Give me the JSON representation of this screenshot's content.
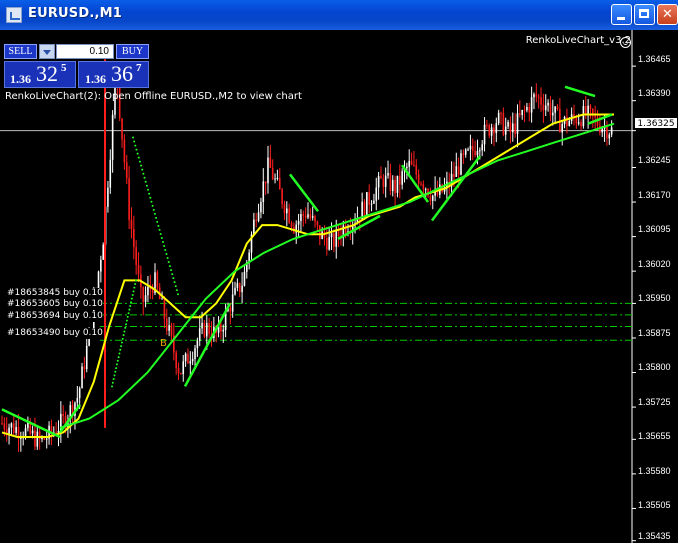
{
  "window": {
    "title": "EURUSD.,M1",
    "controls": [
      "minimize",
      "maximize",
      "close"
    ]
  },
  "trade_panel": {
    "sell_label": "SELL",
    "buy_label": "BUY",
    "lot_value": "0.10",
    "sell_price": {
      "prefix": "1.36",
      "big": "32",
      "sup": "5"
    },
    "buy_price": {
      "prefix": "1.36",
      "big": "36",
      "sup": "7"
    }
  },
  "status_line": "RenkoLiveChart(2): Open Offline EURUSD.,M2 to view chart",
  "indicator_name": "RenkoLiveChart_v3.2",
  "current_price": "1.36325",
  "orders": [
    {
      "label": "#18653845 buy 0.10",
      "price": 1.3595
    },
    {
      "label": "#18653605 buy 0.10",
      "price": 1.35925
    },
    {
      "label": "#18653694 buy 0.10",
      "price": 1.359
    },
    {
      "label": "#18653490 buy 0.10",
      "price": 1.3587
    }
  ],
  "trade_marker": "B",
  "colors": {
    "bull_candle": "#ffffff",
    "bear_candle": "#ff1e1e",
    "ma_fast": "#ffff00",
    "ma_slow": "#22ff22",
    "order_line": "#00c800",
    "accent": "#1c36c8"
  },
  "chart_data": {
    "type": "line",
    "y_axis_ticks": [
      "1.36465",
      "1.36390",
      "1.36325",
      "1.36245",
      "1.36170",
      "1.36095",
      "1.36020",
      "1.35950",
      "1.35875",
      "1.35800",
      "1.35725",
      "1.35655",
      "1.35580",
      "1.35505",
      "1.35435"
    ],
    "ylim": [
      1.3543,
      1.365
    ],
    "series": [
      {
        "values": [
          1.3569,
          1.3568,
          1.3567,
          1.3565,
          1.3567,
          1.357,
          1.3575,
          1.359,
          1.361,
          1.3645,
          1.3615,
          1.3595,
          1.36,
          1.359,
          1.358,
          1.3585,
          1.359,
          1.3588,
          1.3595,
          1.36,
          1.3615,
          1.3625,
          1.3618,
          1.3612,
          1.3615,
          1.361,
          1.3608,
          1.3612,
          1.3614,
          1.3618,
          1.3622,
          1.362,
          1.3625,
          1.3622,
          1.3618,
          1.362,
          1.3625,
          1.3628,
          1.3632,
          1.3635,
          1.3632,
          1.3636,
          1.364,
          1.3638,
          1.3634,
          1.3635,
          1.3636,
          1.3634,
          1.36325
        ]
      },
      {
        "values": [
          1.3567,
          1.3566,
          1.3566,
          1.3566,
          1.3567,
          1.357,
          1.3578,
          1.359,
          1.36,
          1.36,
          1.3598,
          1.3595,
          1.3592,
          1.3592,
          1.3595,
          1.36,
          1.3608,
          1.3612,
          1.3612,
          1.3611,
          1.361,
          1.361,
          1.3611,
          1.3612,
          1.3614,
          1.3615,
          1.3616,
          1.3618,
          1.3619,
          1.362,
          1.3622,
          1.3624,
          1.3626,
          1.3628,
          1.363,
          1.3632,
          1.3634,
          1.3635,
          1.3636,
          1.3636,
          1.3636
        ]
      },
      {
        "values": [
          1.3568,
          1.357,
          1.3574,
          1.358,
          1.3588,
          1.3596,
          1.3602,
          1.3606,
          1.3609,
          1.3611,
          1.3613,
          1.3615,
          1.3617,
          1.362,
          1.3623,
          1.3626,
          1.3628,
          1.363,
          1.3632,
          1.3634
        ]
      }
    ]
  }
}
